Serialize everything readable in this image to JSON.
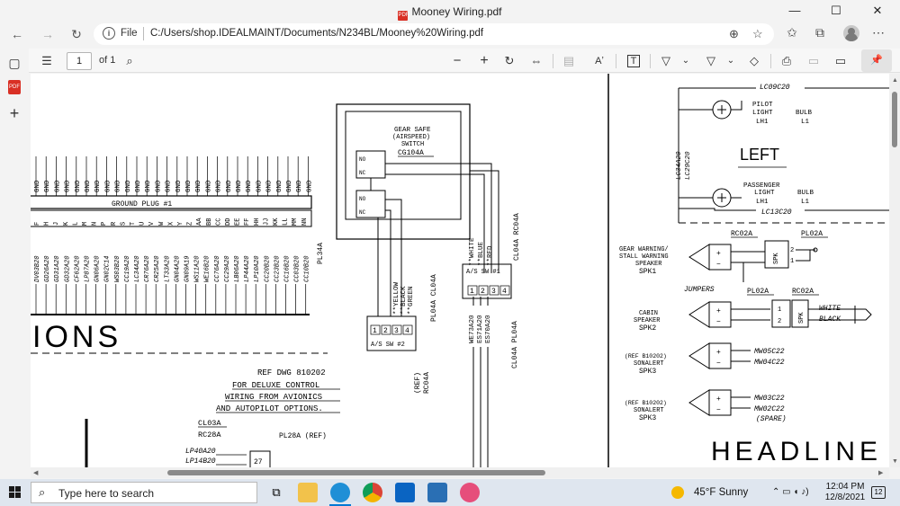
{
  "window": {
    "title": "Mooney Wiring.pdf",
    "pdf_badge": "PDF",
    "minimize_glyph": "—",
    "maximize_glyph": "☐",
    "close_glyph": "✕"
  },
  "address_bar": {
    "back_glyph": "←",
    "forward_glyph": "→",
    "refresh_glyph": "↻",
    "info_glyph": "i",
    "scheme_label": "File",
    "url": "C:/Users/shop.IDEALMAINT/Documents/N234BL/Mooney%20Wiring.pdf",
    "zoom_glyph": "⊕",
    "favorite_glyph": "☆"
  },
  "browser_icons": {
    "favorites_glyph": "✩",
    "collections_glyph": "⧉",
    "menu_glyph": "⋯"
  },
  "sidebar": {
    "tabs_glyph": "▢",
    "new_tab_glyph": "+",
    "pdf_label": "PDF"
  },
  "pdf_toolbar": {
    "contents_glyph": "☰",
    "page_number": "1",
    "page_total": "of 1",
    "find_glyph": "⌕",
    "zoom_out_glyph": "−",
    "zoom_in_glyph": "+",
    "rotate_glyph": "↻",
    "fit_glyph": "⇔",
    "page_view_glyph": "▤",
    "read_aloud_glyph": "Aʼ",
    "text_glyph": "T",
    "draw_glyph": "▽",
    "dropdown_glyph": "⌄",
    "highlight_glyph": "▽",
    "erase_glyph": "◇",
    "print_glyph": "⎙",
    "save_glyph": "▭",
    "save_as_glyph": "▭",
    "pin_glyph": "📌"
  },
  "schematic": {
    "ground_plug": "GROUND PLUG #1",
    "gnd_label": "GND",
    "left_wires": [
      "DV03B20",
      "GD26A20",
      "GD31A20",
      "GD32A20",
      "CF62A20",
      "LP87A20",
      "GN06A20",
      "GN02C14",
      "WS03B20",
      "CC19A20",
      "LC34A20",
      "CR76A20",
      "CR25A20",
      "LT33A20",
      "GN04A20",
      "GN09A19",
      "WS11A20",
      "WE16B20",
      "CC76A20",
      "CC29A20",
      "LB06A20",
      "LP44A20",
      "LP10A20",
      "CC20B20",
      "CC23B20",
      "CC16B20",
      "CC03B20"
    ],
    "left_wires_tail": "CC10B20",
    "pin_letters": [
      "F",
      "H",
      "J",
      "K",
      "L",
      "M",
      "N",
      "P",
      "R",
      "S",
      "T",
      "U",
      "V",
      "W",
      "X",
      "Y",
      "Z",
      "AA",
      "BB",
      "CC",
      "DD",
      "EE",
      "FF",
      "HH",
      "JJ",
      "KK",
      "LL",
      "MM",
      "NN"
    ],
    "pl34a": "PL34A",
    "ions_heading": "IONS",
    "gear_safe_title": "GEAR SAFE",
    "gear_safe_sub": "(AIRSPEED)",
    "gear_safe_sub2": "SWITCH",
    "gear_safe_id": "CG104A",
    "sw_labels": [
      "NO",
      "NC",
      "NO",
      "NC"
    ],
    "as_sw2": "A/S SW #2",
    "as_sw1": "A/S SW #1",
    "sw2_pins": [
      "1",
      "2",
      "3",
      "4"
    ],
    "sw1_pins": [
      "1",
      "2",
      "3",
      "4"
    ],
    "sw2_colors": [
      "**YELLOW",
      "**BLACK",
      "**GREEN"
    ],
    "sw1_colors": [
      "**WHITE",
      "**BLUE",
      "**RED"
    ],
    "pl04a_cl04a": "PL04A CL04A",
    "cl04a_rc04a": "CL04A RC04A",
    "we73a20": "WE73A20",
    "es71a20": "ES71A20",
    "es70a20": "ES70A20",
    "cl04a_pl04a": "CL04A PL04A",
    "ref_rc04a": "(REF)",
    "ref_rc04a2": "RC04A",
    "ref_dwg": "REF DWG 810202",
    "deluxe_1": "FOR DELUXE CONTROL",
    "deluxe_2": "WIRING FROM AVIONICS",
    "deluxe_3": "AND AUTOPILOT OPTIONS.",
    "cl03a": "CL03A",
    "rc28a": "RC28A",
    "pl28a_ref": "PL28A (REF)",
    "lp40a20": "LP40A20",
    "lp14b20": "LP14B20",
    "pin_27": "27",
    "lc09c20": "LC09C20",
    "pilot_light": "PILOT",
    "pilot_light2": "LIGHT",
    "lh1": "LH1",
    "bulb": "BULB",
    "l1": "L1",
    "left_label": "LEFT",
    "lc34a20": "LC34A20",
    "lc29c20": "LC29C20",
    "passenger_light": "PASSENGER",
    "passenger_light2": "LIGHT",
    "lh1b": "LH1",
    "bulb2": "BULB",
    "l1b": "L1",
    "lc13c20": "LC13C20",
    "rc02a_1": "RC02A",
    "pl02a_1": "PL02A",
    "gear_warning_1": "GEAR WARNING/",
    "gear_warning_2": "STALL WARNING",
    "gear_warning_3": "SPEAKER",
    "spk1": "SPK1",
    "spk_tag": "SPK",
    "jumpers": "JUMPERS",
    "pl02a_2": "PL02A",
    "rc02a_2": "RC02A",
    "cabin_1": "CABIN",
    "cabin_2": "SPEAKER",
    "spk2": "SPK2",
    "white": "WHITE",
    "black": "BLACK",
    "ref_b10202_a": "(REF B10202)",
    "sonalert_a": "SONALERT",
    "spk3a": "SPK3",
    "mw05c22": "MW05C22",
    "mw04c22": "MW04C22",
    "ref_b10202_b": "(REF B10202)",
    "sonalert_b": "SONALERT",
    "spk3b": "SPK3",
    "mw03c22": "MW03C22",
    "mw02c22": "MW02C22",
    "spare": "(SPARE)",
    "headline": "HEADLINE",
    "plus": "+",
    "minus": "−",
    "one": "1",
    "two": "2"
  },
  "taskbar": {
    "search_placeholder": "Type here to search",
    "search_glyph": "⌕",
    "weather": "45°F  Sunny",
    "time": "12:04 PM",
    "date": "12/8/2021",
    "notification_count": "12",
    "tray_glyphs": "⌃  ▭  ◖  ♪)"
  },
  "colors": {
    "accent": "#0078d4",
    "pdf_red": "#d93025"
  }
}
